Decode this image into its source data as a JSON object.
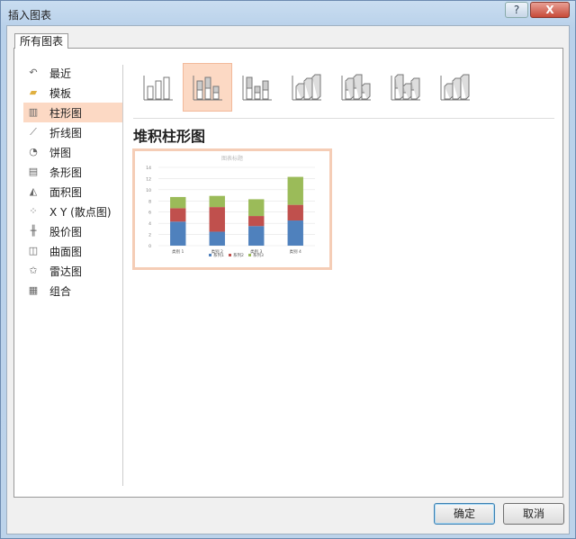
{
  "window": {
    "title": "插入图表",
    "help_label": "?",
    "close_label": "X"
  },
  "tab": {
    "label": "所有图表"
  },
  "sidebar": {
    "items": [
      {
        "label": "最近",
        "icon": "undo-icon"
      },
      {
        "label": "模板",
        "icon": "folder-icon"
      },
      {
        "label": "柱形图",
        "icon": "column-chart-icon"
      },
      {
        "label": "折线图",
        "icon": "line-chart-icon"
      },
      {
        "label": "饼图",
        "icon": "pie-chart-icon"
      },
      {
        "label": "条形图",
        "icon": "bar-chart-icon"
      },
      {
        "label": "面积图",
        "icon": "area-chart-icon"
      },
      {
        "label": "X Y (散点图)",
        "icon": "scatter-chart-icon"
      },
      {
        "label": "股价图",
        "icon": "stock-chart-icon"
      },
      {
        "label": "曲面图",
        "icon": "surface-chart-icon"
      },
      {
        "label": "雷达图",
        "icon": "radar-chart-icon"
      },
      {
        "label": "组合",
        "icon": "combo-chart-icon"
      }
    ],
    "selected": 2
  },
  "subtypes": {
    "selected": 1,
    "heading": "堆积柱形图"
  },
  "chart_data": {
    "type": "bar",
    "stacked": true,
    "title": "图表标题",
    "categories": [
      "类别 1",
      "类别 2",
      "类别 3",
      "类别 4"
    ],
    "series": [
      {
        "name": "系列1",
        "values": [
          4.3,
          2.5,
          3.5,
          4.5
        ],
        "color": "#4f81bd"
      },
      {
        "name": "系列2",
        "values": [
          2.4,
          4.4,
          1.8,
          2.8
        ],
        "color": "#c0504d"
      },
      {
        "name": "系列3",
        "values": [
          2,
          2,
          3,
          5
        ],
        "color": "#9bbb59"
      }
    ],
    "ylim": [
      0,
      14
    ],
    "yticks": [
      0,
      2,
      4,
      6,
      8,
      10,
      12,
      14
    ],
    "grid": true,
    "legend": "bottom"
  },
  "buttons": {
    "ok": "确定",
    "cancel": "取消"
  }
}
